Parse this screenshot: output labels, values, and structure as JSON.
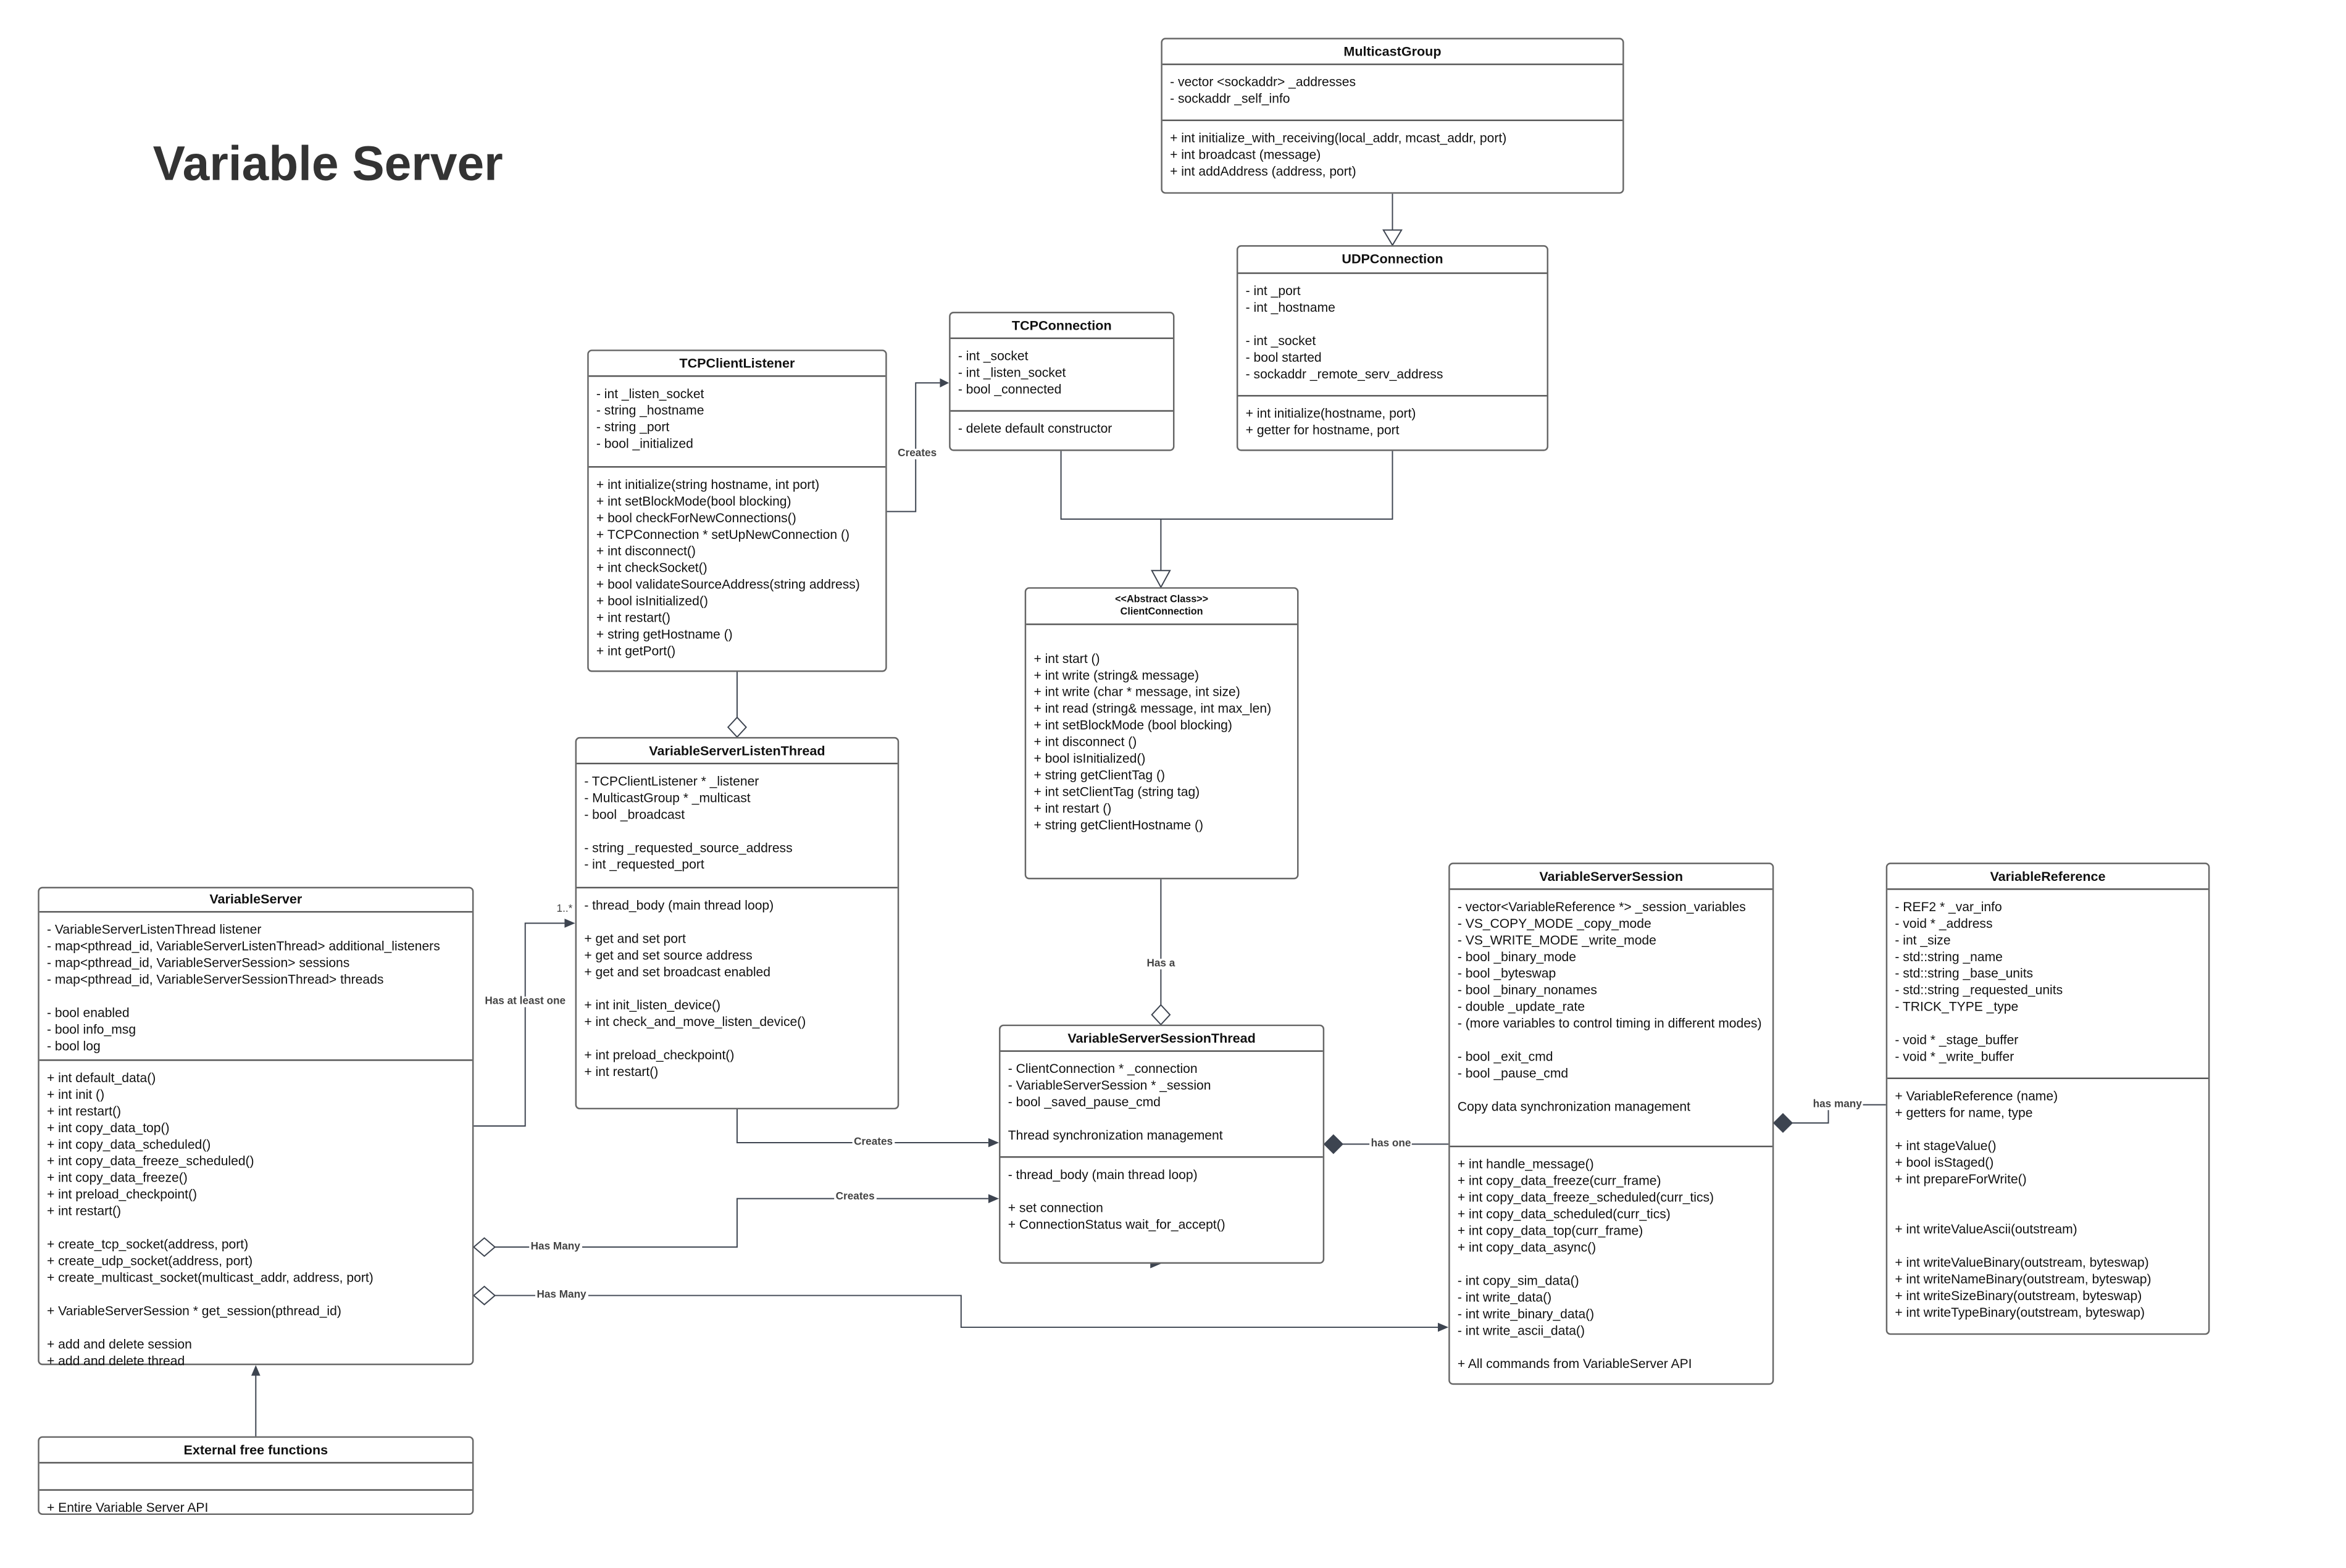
{
  "title": "Variable Server",
  "colors": {
    "line": "#3d4450",
    "border": "#666666",
    "text": "#111111",
    "title": "#333333"
  },
  "classes": {
    "multicast_group": {
      "name": "MulticastGroup",
      "attributes": [
        "- vector <sockaddr> _addresses",
        "- sockaddr _self_info"
      ],
      "methods": [
        "+ int initialize_with_receiving(local_addr, mcast_addr, port)",
        "+ int broadcast (message)",
        "+ int addAddress (address, port)"
      ]
    },
    "udp_connection": {
      "name": "UDPConnection",
      "attributes": [
        "- int _port",
        "- int _hostname",
        "",
        "- int _socket",
        "- bool started",
        "- sockaddr _remote_serv_address"
      ],
      "methods": [
        "+ int initialize(hostname, port)",
        "+ getter for hostname, port"
      ]
    },
    "tcp_connection": {
      "name": "TCPConnection",
      "attributes": [
        "- int _socket",
        "- int _listen_socket",
        "- bool _connected"
      ],
      "methods": [
        "- delete default constructor"
      ]
    },
    "tcp_client_listener": {
      "name": "TCPClientListener",
      "attributes": [
        "- int _listen_socket",
        "- string _hostname",
        "- string _port",
        "- bool _initialized"
      ],
      "methods": [
        "+ int initialize(string hostname, int port)",
        "+ int setBlockMode(bool blocking)",
        "+ bool checkForNewConnections()",
        "+ TCPConnection * setUpNewConnection ()",
        "+ int disconnect()",
        "+ int checkSocket()",
        "+ bool validateSourceAddress(string address)",
        "+ bool isInitialized()",
        "+ int restart()",
        "+ string getHostname ()",
        "+ int getPort()"
      ]
    },
    "client_connection": {
      "stereotype": "<<Abstract Class>>",
      "name": "ClientConnection",
      "attributes": [],
      "methods": [
        "",
        "+ int start ()",
        "+ int write (string& message)",
        "+ int write (char * message, int size)",
        "+ int read  (string& message, int max_len)",
        "+ int setBlockMode (bool blocking)",
        "+ int disconnect ()",
        "+ bool isInitialized()",
        "+ string getClientTag ()",
        "+ int setClientTag (string tag)",
        "+ int restart ()",
        "+ string getClientHostname ()"
      ]
    },
    "listen_thread": {
      "name": "VariableServerListenThread",
      "attributes": [
        "- TCPClientListener * _listener",
        "- MulticastGroup * _multicast",
        "- bool _broadcast",
        "",
        "- string _requested_source_address",
        "- int _requested_port"
      ],
      "methods": [
        "- thread_body (main thread loop)",
        "",
        "+ get and set port",
        "+ get and set source address",
        "+ get and set broadcast enabled",
        "",
        "+ int init_listen_device()",
        "+ int check_and_move_listen_device()",
        "",
        "+ int preload_checkpoint()",
        "+ int restart()"
      ]
    },
    "variable_server": {
      "name": "VariableServer",
      "attributes": [
        "- VariableServerListenThread listener",
        "- map<pthread_id, VariableServerListenThread> additional_listeners",
        "- map<pthread_id, VariableServerSession> sessions",
        "- map<pthread_id, VariableServerSessionThread> threads",
        "",
        "- bool enabled",
        "- bool info_msg",
        "- bool log"
      ],
      "methods": [
        "+ int default_data()",
        "+ int init ()",
        "+ int restart()",
        "+ int copy_data_top()",
        "+ int copy_data_scheduled()",
        "+ int copy_data_freeze_scheduled()",
        "+ int copy_data_freeze()",
        "+ int preload_checkpoint()",
        "+ int restart()",
        "",
        "+ create_tcp_socket(address, port)",
        "+ create_udp_socket(address, port)",
        "+ create_multicast_socket(multicast_addr, address, port)",
        "",
        "+ VariableServerSession * get_session(pthread_id)",
        "",
        "+ add and delete session",
        "+ add and delete thread"
      ]
    },
    "external_free_functions": {
      "name": "External free functions",
      "attributes": [],
      "methods": [
        "+ Entire Variable Server API"
      ]
    },
    "session_thread": {
      "name": "VariableServerSessionThread",
      "attributes": [
        "- ClientConnection * _connection",
        "- VariableServerSession * _session",
        "- bool _saved_pause_cmd",
        "",
        "Thread synchronization management"
      ],
      "methods": [
        "- thread_body (main thread loop)",
        "",
        "+ set connection",
        "+ ConnectionStatus wait_for_accept()"
      ]
    },
    "session": {
      "name": "VariableServerSession",
      "attributes": [
        "- vector<VariableReference *> _session_variables",
        "- VS_COPY_MODE  _copy_mode",
        "- VS_WRITE_MODE _write_mode",
        "- bool _binary_mode",
        "- bool _byteswap",
        "- bool _binary_nonames",
        "- double _update_rate",
        "- (more variables to control timing in different modes)",
        "",
        "- bool _exit_cmd",
        "- bool _pause_cmd",
        "",
        "Copy data synchronization management"
      ],
      "methods": [
        "+ int handle_message()",
        "+ int copy_data_freeze(curr_frame)",
        "+ int copy_data_freeze_scheduled(curr_tics)",
        "+ int copy_data_scheduled(curr_tics)",
        "+ int copy_data_top(curr_frame)",
        "+ int copy_data_async()",
        "",
        "- int copy_sim_data()",
        "- int write_data()",
        "- int write_binary_data()",
        "- int write_ascii_data()",
        "",
        "+ All commands from VariableServer API"
      ]
    },
    "variable_reference": {
      "name": "VariableReference",
      "attributes": [
        "- REF2 * _var_info",
        "- void * _address",
        "- int _size",
        "- std::string _name",
        "- std::string _base_units",
        "- std::string _requested_units",
        "- TRICK_TYPE _type",
        "",
        "- void * _stage_buffer",
        "- void * _write_buffer"
      ],
      "methods": [
        "+ VariableReference (name)",
        "+ getters for name, type",
        "",
        "+ int stageValue()",
        "+ bool isStaged()",
        "+ int prepareForWrite()",
        "",
        "",
        "+ int writeValueAscii(outstream)",
        "",
        "+ int writeValueBinary(outstream, byteswap)",
        "+ int writeNameBinary(outstream, byteswap)",
        "+ int writeSizeBinary(outstream, byteswap)",
        "+ int writeTypeBinary(outstream, byteswap)"
      ]
    }
  },
  "relations": {
    "tcp_creates": {
      "label": "Creates",
      "type": "association"
    },
    "listener_aggregation": {
      "type": "aggregation"
    },
    "has_a": {
      "label": "Has a",
      "type": "aggregation"
    },
    "has_at_least_one": {
      "label": "Has at least one",
      "multiplicity": "1..*",
      "type": "association"
    },
    "listen_creates": {
      "label": "Creates",
      "type": "association"
    },
    "has_many_threads": {
      "label": "Has Many",
      "type": "aggregation"
    },
    "thread_creates": {
      "label": "Creates",
      "type": "association"
    },
    "has_many_sessions": {
      "label": "Has Many",
      "type": "aggregation"
    },
    "has_one": {
      "label": "has one",
      "type": "composition"
    },
    "has_many_refs": {
      "label": "has many",
      "type": "composition"
    },
    "udp_inherits_multicast": {
      "type": "generalization"
    },
    "connections_inherit_client": {
      "type": "generalization"
    },
    "external_uses_server": {
      "type": "association"
    }
  }
}
